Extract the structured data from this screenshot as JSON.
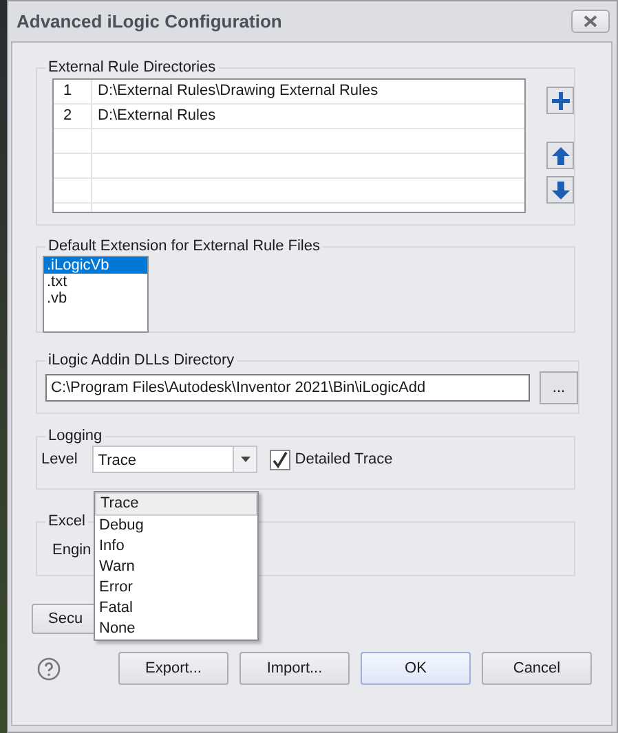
{
  "window": {
    "title": "Advanced iLogic Configuration"
  },
  "external_rule_directories": {
    "title": "External Rule Directories",
    "rows": [
      {
        "index": "1",
        "path": "D:\\External Rules\\Drawing External Rules"
      },
      {
        "index": "2",
        "path": "D:\\External Rules"
      }
    ]
  },
  "default_extension": {
    "title": "Default Extension for External Rule Files",
    "items": [
      {
        "label": ".iLogicVb",
        "selected": true
      },
      {
        "label": ".txt",
        "selected": false
      },
      {
        "label": ".vb",
        "selected": false
      }
    ]
  },
  "addin_dlls_directory": {
    "title": "iLogic Addin DLLs Directory",
    "value": "C:\\Program Files\\Autodesk\\Inventor 2021\\Bin\\iLogicAdd",
    "browse_button": "..."
  },
  "logging": {
    "title": "Logging",
    "level_label": "Level",
    "level_value": "Trace",
    "detailed_trace": {
      "label": "Detailed Trace",
      "checked": true
    },
    "dropdown_open": true,
    "options": [
      {
        "label": "Trace",
        "selected": true
      },
      {
        "label": "Debug",
        "selected": false
      },
      {
        "label": "Info",
        "selected": false
      },
      {
        "label": "Warn",
        "selected": false
      },
      {
        "label": "Error",
        "selected": false
      },
      {
        "label": "Fatal",
        "selected": false
      },
      {
        "label": "None",
        "selected": false
      }
    ]
  },
  "excel": {
    "title": "Excel",
    "engine_label": "Engin"
  },
  "security_button": "Secu",
  "buttons": [
    "Export...",
    "Import...",
    "OK",
    "Cancel"
  ]
}
